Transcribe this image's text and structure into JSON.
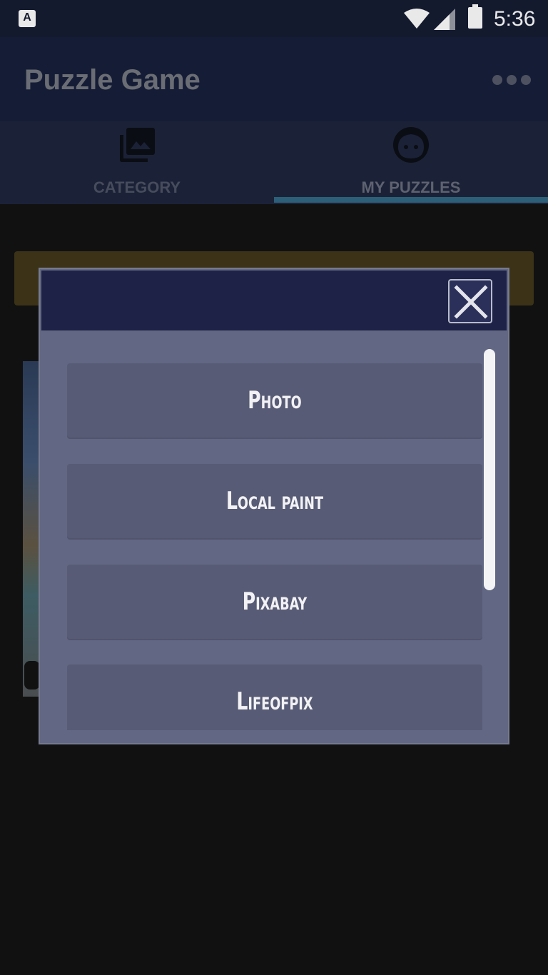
{
  "status_bar": {
    "time": "5:36",
    "badge_letter": "A"
  },
  "app_bar": {
    "title": "Puzzle Game",
    "menu_icon": "overflow-dots-icon"
  },
  "tabs": [
    {
      "label": "CATEGORY",
      "icon": "photo-library-icon",
      "selected": false
    },
    {
      "label": "MY PUZZLES",
      "icon": "face-icon",
      "selected": true
    }
  ],
  "dialog": {
    "close_icon": "close-icon",
    "options": [
      {
        "label": "Photo"
      },
      {
        "label": "Local paint"
      },
      {
        "label": "Pixabay"
      },
      {
        "label": "Lifeofpix"
      }
    ]
  },
  "colors": {
    "app_bar": "#151d36",
    "tab_indicator": "#2e5f78",
    "dialog_background": "#626783",
    "dialog_header": "#1e2246",
    "option_button": "#585b75"
  }
}
